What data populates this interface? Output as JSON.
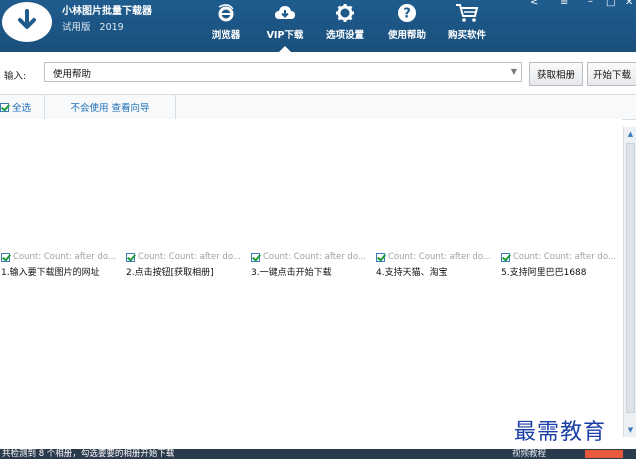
{
  "app": {
    "title": "小林图片批量下载器",
    "edition": "试用版",
    "year": "2019"
  },
  "nav": {
    "items": [
      {
        "label": "浏览器",
        "icon": "ie-browser-icon"
      },
      {
        "label": "VIP下载",
        "icon": "cloud-download-icon",
        "active": true
      },
      {
        "label": "选项设置",
        "icon": "gear-icon"
      },
      {
        "label": "使用帮助",
        "icon": "help-icon"
      },
      {
        "label": "购买软件",
        "icon": "cart-icon"
      }
    ]
  },
  "input": {
    "label": "输入:",
    "value": "使用帮助"
  },
  "buttons": {
    "fetch": "获取相册",
    "start": "开始下载"
  },
  "tabs": {
    "select_all": "全选",
    "guide": "不会使用 查看向导"
  },
  "items": [
    {
      "count": "Count: Count: after do...",
      "label": "1.输入要下载图片的网址"
    },
    {
      "count": "Count: Count: after do...",
      "label": "2.点击按钮[获取相册]"
    },
    {
      "count": "Count: Count: after do...",
      "label": "3.一键点击开始下载"
    },
    {
      "count": "Count: Count: after do...",
      "label": "4.支持天猫、淘宝"
    },
    {
      "count": "Count: Count: after do...",
      "label": "5.支持阿里巴巴1688"
    }
  ],
  "watermark": "最需教育",
  "status": {
    "message": "共检测到 8 个相册，勾选要要的相册开始下载",
    "right": "视频教程"
  },
  "colors": {
    "titlebar": "#1f5c8e",
    "accent": "#1e6fb8",
    "check": "#1b9b3a",
    "statusbar": "#2b3b4c"
  }
}
